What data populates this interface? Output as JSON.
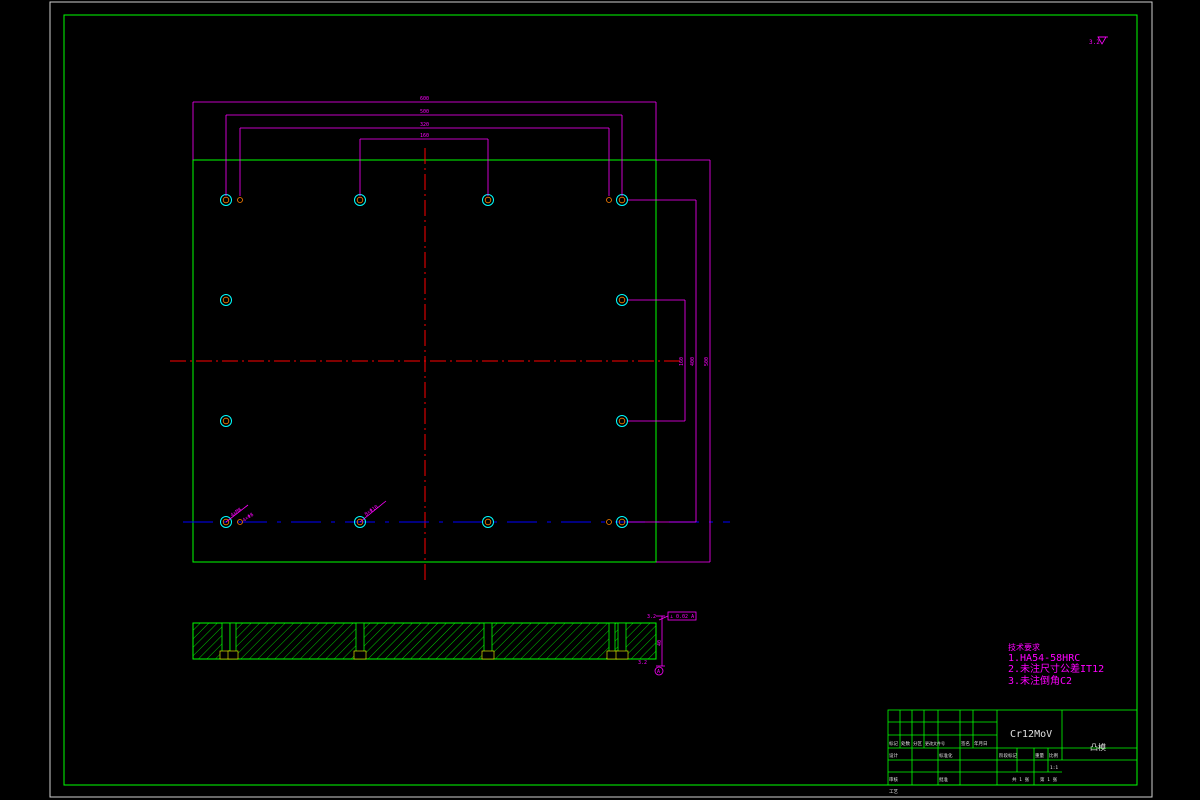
{
  "drawing": {
    "colors": {
      "background": "#000000",
      "border": "#00ff00",
      "outline": "#00ff00",
      "dimension": "#ff00ff",
      "centerline": "#ff0000",
      "hidden_line": "#0000ff",
      "hole_outer": "#00ffff",
      "hole_inner": "#ff8000",
      "hatch": "#00ff00",
      "text": "#e0e0e0",
      "note": "#ff00ff"
    },
    "roughness_mark": "3.2",
    "dimensions": {
      "overall_width": "600",
      "span_1": "500",
      "span_2": "320",
      "span_3": "160",
      "right_inner": "160",
      "right_mid": "400",
      "right_outer": "500",
      "hole_callout_1": "4×M8",
      "hole_callout_2": "4×Φ8",
      "hole_callout_3": "8×Φ10",
      "section_thickness": "40",
      "section_callout": "⊥ 0.02 A",
      "datum": "A"
    },
    "technical_notes": {
      "heading": "技术要求",
      "items": [
        "1.HA54-58HRC",
        "2.未注尺寸公差IT12",
        "3.未注倒角C2"
      ]
    },
    "title_block": {
      "material": "Cr12MoV",
      "part_name": "凸模",
      "scale_label": "比例",
      "scale_value": "1:1",
      "sheet_label": "共 1 张",
      "sheet_index": "第 1 张",
      "design_label": "设计",
      "review_label": "审核",
      "approve_label": "批准",
      "standard_label": "标准化",
      "process_label": "工艺",
      "mark_label": "标记",
      "count_label": "处数",
      "zone_label": "分区",
      "doc_label": "更改文件号",
      "sign_label": "签名",
      "date_label": "年月日",
      "stage_label": "阶段标记",
      "weight_label": "重量",
      "ratio_label": "比例"
    }
  }
}
